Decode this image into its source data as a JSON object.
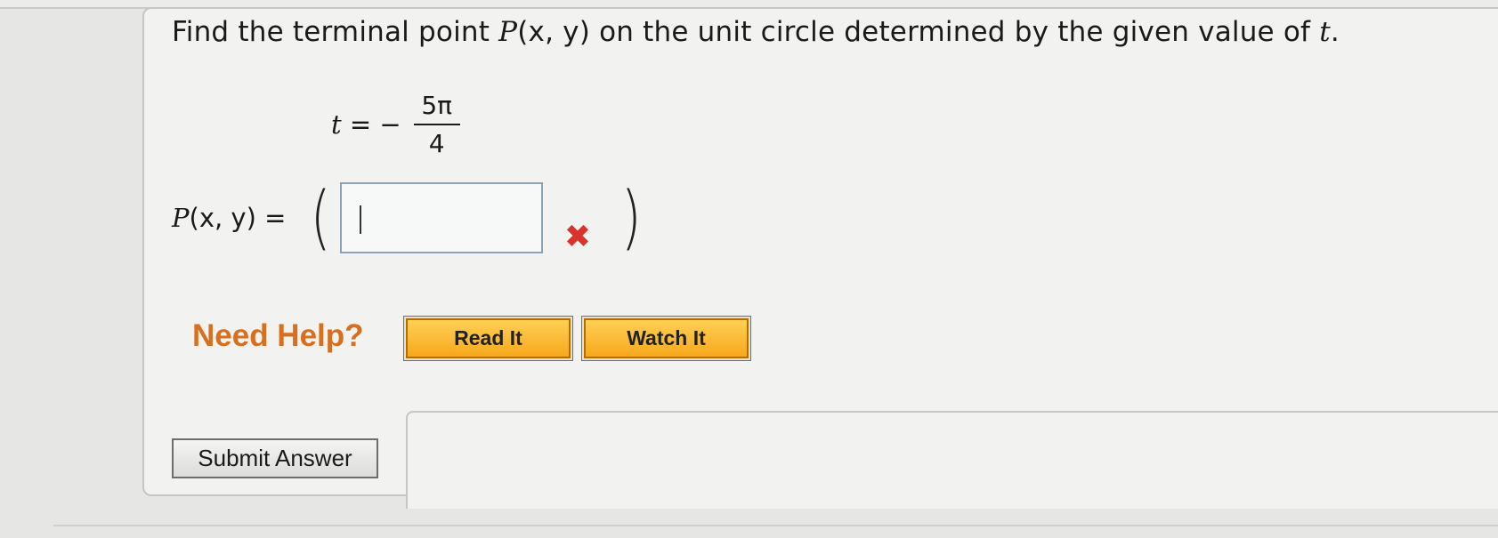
{
  "question": {
    "prefix": "Find the terminal point ",
    "point_var": "P",
    "point_args": "(x, y)",
    "suffix": " on the unit circle determined by the given value of ",
    "t_var": "t",
    "end": "."
  },
  "given": {
    "lhs_var": "t",
    "relation": " = −",
    "numerator": "5π",
    "denominator": "4"
  },
  "answer": {
    "label_var": "P",
    "label_args": "(x, y) =",
    "open_paren": "(",
    "close_paren": ")",
    "input_value": "",
    "status_icon": "✖",
    "status": "incorrect"
  },
  "help": {
    "label": "Need Help?",
    "read_button": "Read It",
    "watch_button": "Watch It"
  },
  "submit": {
    "label": "Submit Answer"
  },
  "colors": {
    "help_text": "#d86f1f",
    "help_button": "#f6a81c",
    "error": "#d9342c",
    "input_border": "#8da3b8"
  }
}
